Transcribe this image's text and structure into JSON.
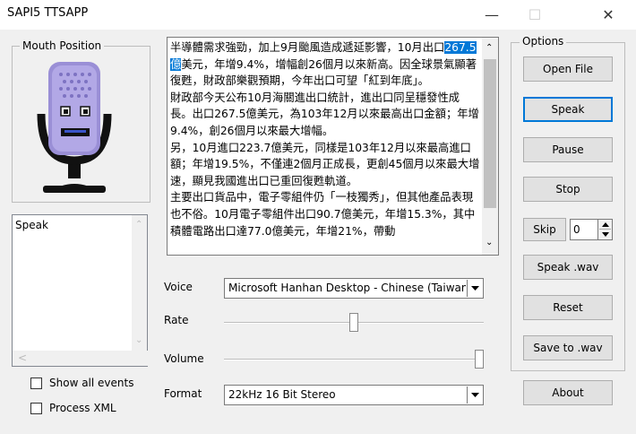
{
  "window": {
    "title": "SAPI5 TTSAPP",
    "minimize": "—",
    "maximize": "☐",
    "close": "✕"
  },
  "mouth_group": {
    "label": "Mouth Position"
  },
  "events": {
    "items": [
      "Speak"
    ],
    "scroll_left": "<",
    "scroll_right": ">"
  },
  "checkboxes": {
    "show_all_events": "Show all events",
    "process_xml": "Process XML"
  },
  "text": {
    "before": "半導體需求強勁，加上9月颱風造成遞延影響，10月出口",
    "selected": "267.5億",
    "after": "美元，年增9.4%，增幅創26個月以來新高。因全球景氣顯著復甦，財政部樂觀預期，今年出口可望「紅到年底」。\n財政部今天公布10月海關進出口統計，進出口同呈穩發性成長。出口267.5億美元，為103年12月以來最高出口金額；年增9.4%，創26個月以來最大增幅。\n另，10月進口223.7億美元，同樣是103年12月以來最高進口額；年增19.5%，不僅連2個月正成長，更創45個月以來最大增速，顯見我國進出口已重回復甦軌道。\n主要出口貨品中，電子零組件仍「一枝獨秀」，但其他產品表現也不俗。10月電子零組件出口90.7億美元，年增15.3%，其中積體電路出口達77.0億美元，年增21%，帶動"
  },
  "voice": {
    "label": "Voice",
    "value": "Microsoft Hanhan Desktop - Chinese (Taiwan)"
  },
  "rate": {
    "label": "Rate",
    "value_fraction": 0.5
  },
  "volume": {
    "label": "Volume",
    "value_fraction": 1.0
  },
  "format": {
    "label": "Format",
    "value": "22kHz 16 Bit Stereo"
  },
  "options": {
    "label": "Options",
    "open_file": "Open File",
    "speak": "Speak",
    "pause": "Pause",
    "stop": "Stop",
    "skip": "Skip",
    "skip_value": "0",
    "speak_wav": "Speak .wav",
    "reset": "Reset",
    "save_wav": "Save to .wav",
    "about": "About"
  }
}
